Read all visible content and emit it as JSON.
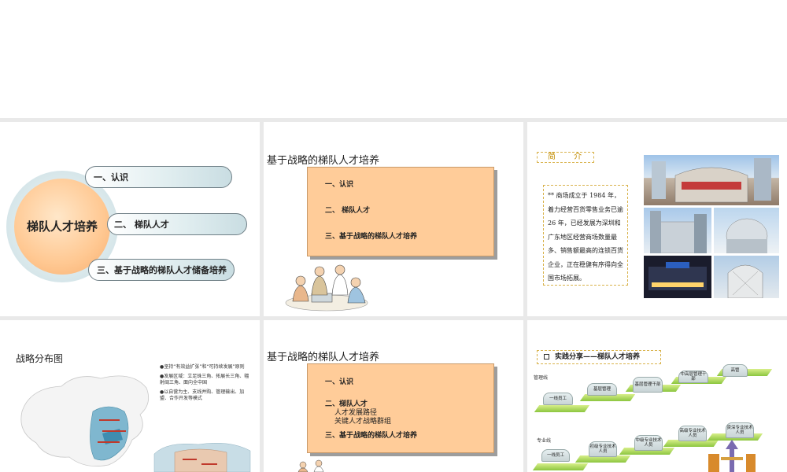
{
  "slide1": {
    "center": "梯队人才培养",
    "items": [
      "一、认识",
      "二、 梯队人才",
      "三、基于战略的梯队人才储备培养"
    ]
  },
  "slide2": {
    "title": "基于战略的梯队人才培养",
    "items": [
      "一、认识",
      "二、 梯队人才",
      "三、基于战略的梯队人才培养"
    ]
  },
  "slide3": {
    "title": "简 介",
    "text": "** 商场成立于 1984 年，着力经营百货零售业务已逾 26 年，已经发展为深圳和广东地区经营商场数量最多、销售额最高的连锁百货企业，正在稳健有序得向全国市场拓展。"
  },
  "slide4": {
    "title": "战略分布图",
    "bullets": [
      "●坚持“有效益扩张”和“可持续发展”原则",
      "●发展区域：立足珠三角、拓展长三角、辐射闽三角、面向全中国",
      "●以自营为主、支线并购、管理输出、加盟、合作开发等模式"
    ]
  },
  "slide5": {
    "title": "基于战略的梯队人才培养",
    "item1": "一、认识",
    "item2": "二、梯队人才",
    "item2_sub1": "人才发展路径",
    "item2_sub2": "关键人才战略群组",
    "item3": "三、基于战略的梯队人才培养"
  },
  "slide6": {
    "title": "实践分享——梯队人才培养",
    "lane_management": "管理线",
    "lane_professional": "专业线",
    "management_steps": [
      "一线员工",
      "基层管理",
      "基层管理干部",
      "中高层管理干部",
      "高管"
    ],
    "professional_steps": [
      "一线员工",
      "初级专业技术人员",
      "中级专业技术人员",
      "高级专业技术人员",
      "资深专业技术人员"
    ]
  }
}
